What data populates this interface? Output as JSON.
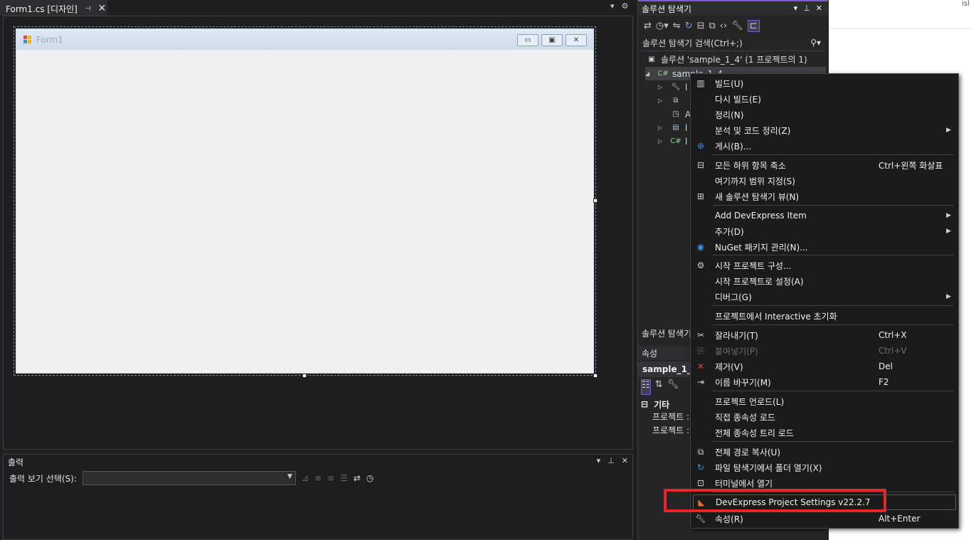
{
  "designer": {
    "tab_label": "Form1.cs [디자인]",
    "form_title": "Form1"
  },
  "output": {
    "title": "출력",
    "source_label": "출력 보기 선택(S):",
    "source_value": ""
  },
  "solution_explorer": {
    "title": "솔루션 탐색기",
    "search_placeholder": "솔루션 탐색기 검색(Ctrl+;)",
    "solution_node": "솔루션 'sample_1_4' (1 프로젝트의 1)",
    "project_node": "sample_1_4",
    "collapsed_rows": [
      "l",
      "",
      "A",
      "l",
      "l"
    ],
    "footer_title": "솔루션 탐색기"
  },
  "properties": {
    "title": "속성",
    "object": "sample_1_4",
    "category": "기타",
    "rows": [
      "프로젝트 :",
      "프로젝트 :"
    ]
  },
  "context_menu": {
    "items": [
      {
        "label": "빌드(U)",
        "icon": "build-icon"
      },
      {
        "label": "다시 빌드(E)"
      },
      {
        "label": "정리(N)"
      },
      {
        "label": "분석 및 코드 정리(Z)",
        "submenu": true
      },
      {
        "label": "게시(B)...",
        "icon": "globe-icon"
      },
      {
        "label": "모든 하위 항목 축소",
        "shortcut": "Ctrl+왼쪽 화살표",
        "icon": "collapse-icon"
      },
      {
        "label": "여기까지 범위 지정(S)"
      },
      {
        "label": "새 솔루션 탐색기 뷰(N)",
        "icon": "new-view-icon"
      },
      {
        "label": "Add DevExpress Item",
        "submenu": true
      },
      {
        "label": "추가(D)",
        "submenu": true
      },
      {
        "label": "NuGet 패키지 관리(N)...",
        "icon": "nuget-icon"
      },
      {
        "label": "시작 프로젝트 구성...",
        "icon": "gear-icon"
      },
      {
        "label": "시작 프로젝트로 설정(A)"
      },
      {
        "label": "디버그(G)",
        "submenu": true
      },
      {
        "label": "프로젝트에서 Interactive 초기화"
      },
      {
        "label": "잘라내기(T)",
        "shortcut": "Ctrl+X",
        "icon": "cut-icon"
      },
      {
        "label": "붙여넣기(P)",
        "shortcut": "Ctrl+V",
        "icon": "paste-icon",
        "disabled": true
      },
      {
        "label": "제거(V)",
        "shortcut": "Del",
        "icon": "delete-icon"
      },
      {
        "label": "이름 바꾸기(M)",
        "shortcut": "F2",
        "icon": "rename-icon"
      },
      {
        "label": "프로젝트 언로드(L)"
      },
      {
        "label": "직접 종속성 로드"
      },
      {
        "label": "전체 종속성 트리 로드"
      },
      {
        "label": "전체 경로 복사(U)",
        "icon": "copy-icon"
      },
      {
        "label": "파일 탐색기에서 폴더 열기(X)",
        "icon": "open-folder-icon"
      },
      {
        "label": "터미널에서 열기",
        "icon": "terminal-icon"
      },
      {
        "label": "DevExpress Project Settings v22.2.7",
        "icon": "devexpress-icon",
        "highlighted": true
      },
      {
        "label": "속성(R)",
        "shortcut": "Alt+Enter",
        "icon": "wrench-icon"
      }
    ]
  },
  "right_edge_text": "isl"
}
